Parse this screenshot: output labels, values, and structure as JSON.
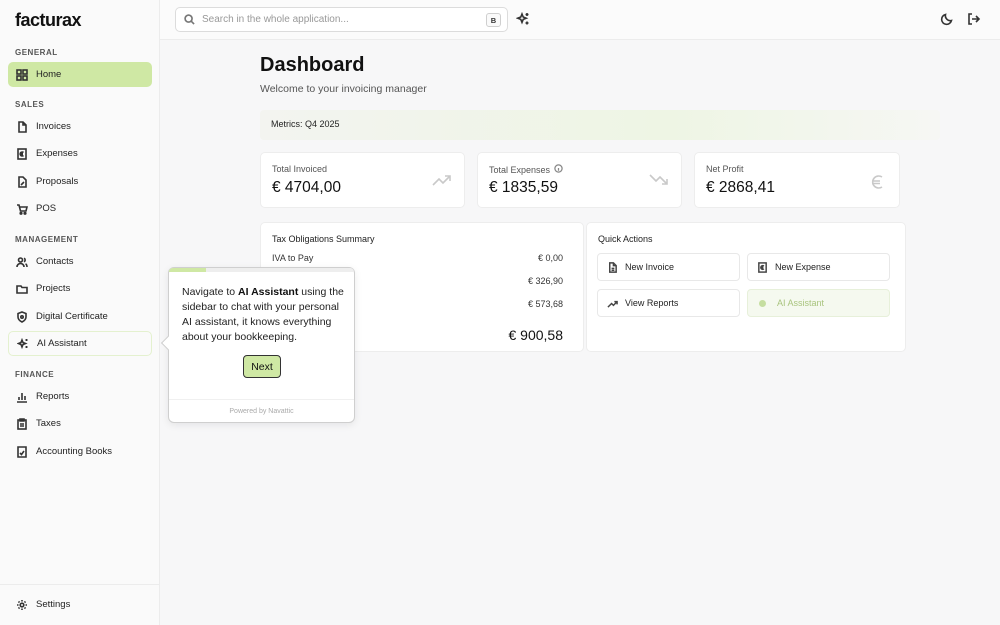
{
  "app": {
    "logo": "facturax"
  },
  "sidebar": {
    "sections": {
      "general": "GENERAL",
      "sales": "SALES",
      "management": "MANAGEMENT",
      "finance": "FINANCE"
    },
    "items": {
      "home": "Home",
      "invoices": "Invoices",
      "expenses": "Expenses",
      "proposals": "Proposals",
      "pos": "POS",
      "contacts": "Contacts",
      "projects": "Projects",
      "digital_certificate": "Digital Certificate",
      "ai_assistant": "AI Assistant",
      "reports": "Reports",
      "taxes": "Taxes",
      "accounting_books": "Accounting Books",
      "settings": "Settings"
    }
  },
  "topbar": {
    "search_placeholder": "Search in the whole application...",
    "search_shortcut": "B"
  },
  "main": {
    "title": "Dashboard",
    "subtitle": "Welcome to your invoicing manager",
    "metrics_label": "Metrics: Q4 2025",
    "stats": {
      "total_invoiced": {
        "label": "Total Invoiced",
        "value": "€ 4704,00"
      },
      "total_expenses": {
        "label": "Total Expenses",
        "value": "€ 1835,59"
      },
      "net_profit": {
        "label": "Net Profit",
        "value": "€ 2868,41"
      }
    },
    "tax": {
      "title": "Tax Obligations Summary",
      "rows": [
        {
          "label": "IVA to Pay",
          "value": "€ 0,00"
        },
        {
          "label": "",
          "value": "€ 326,90"
        },
        {
          "label": "",
          "value": "€ 573,68"
        }
      ],
      "total": "€ 900,58"
    },
    "quick_actions": {
      "title": "Quick Actions",
      "new_invoice": "New Invoice",
      "new_expense": "New Expense",
      "view_reports": "View Reports",
      "ai_assistant": "AI Assistant"
    }
  },
  "tour": {
    "text_before": "Navigate to ",
    "text_bold": "AI Assistant",
    "text_after": " using the sidebar to chat with your personal AI assistant, it knows everything about your bookkeeping.",
    "next_label": "Next",
    "powered_by": "Powered by Navattic",
    "progress": 0.2
  },
  "colors": {
    "accent": "#cfe8a4"
  }
}
